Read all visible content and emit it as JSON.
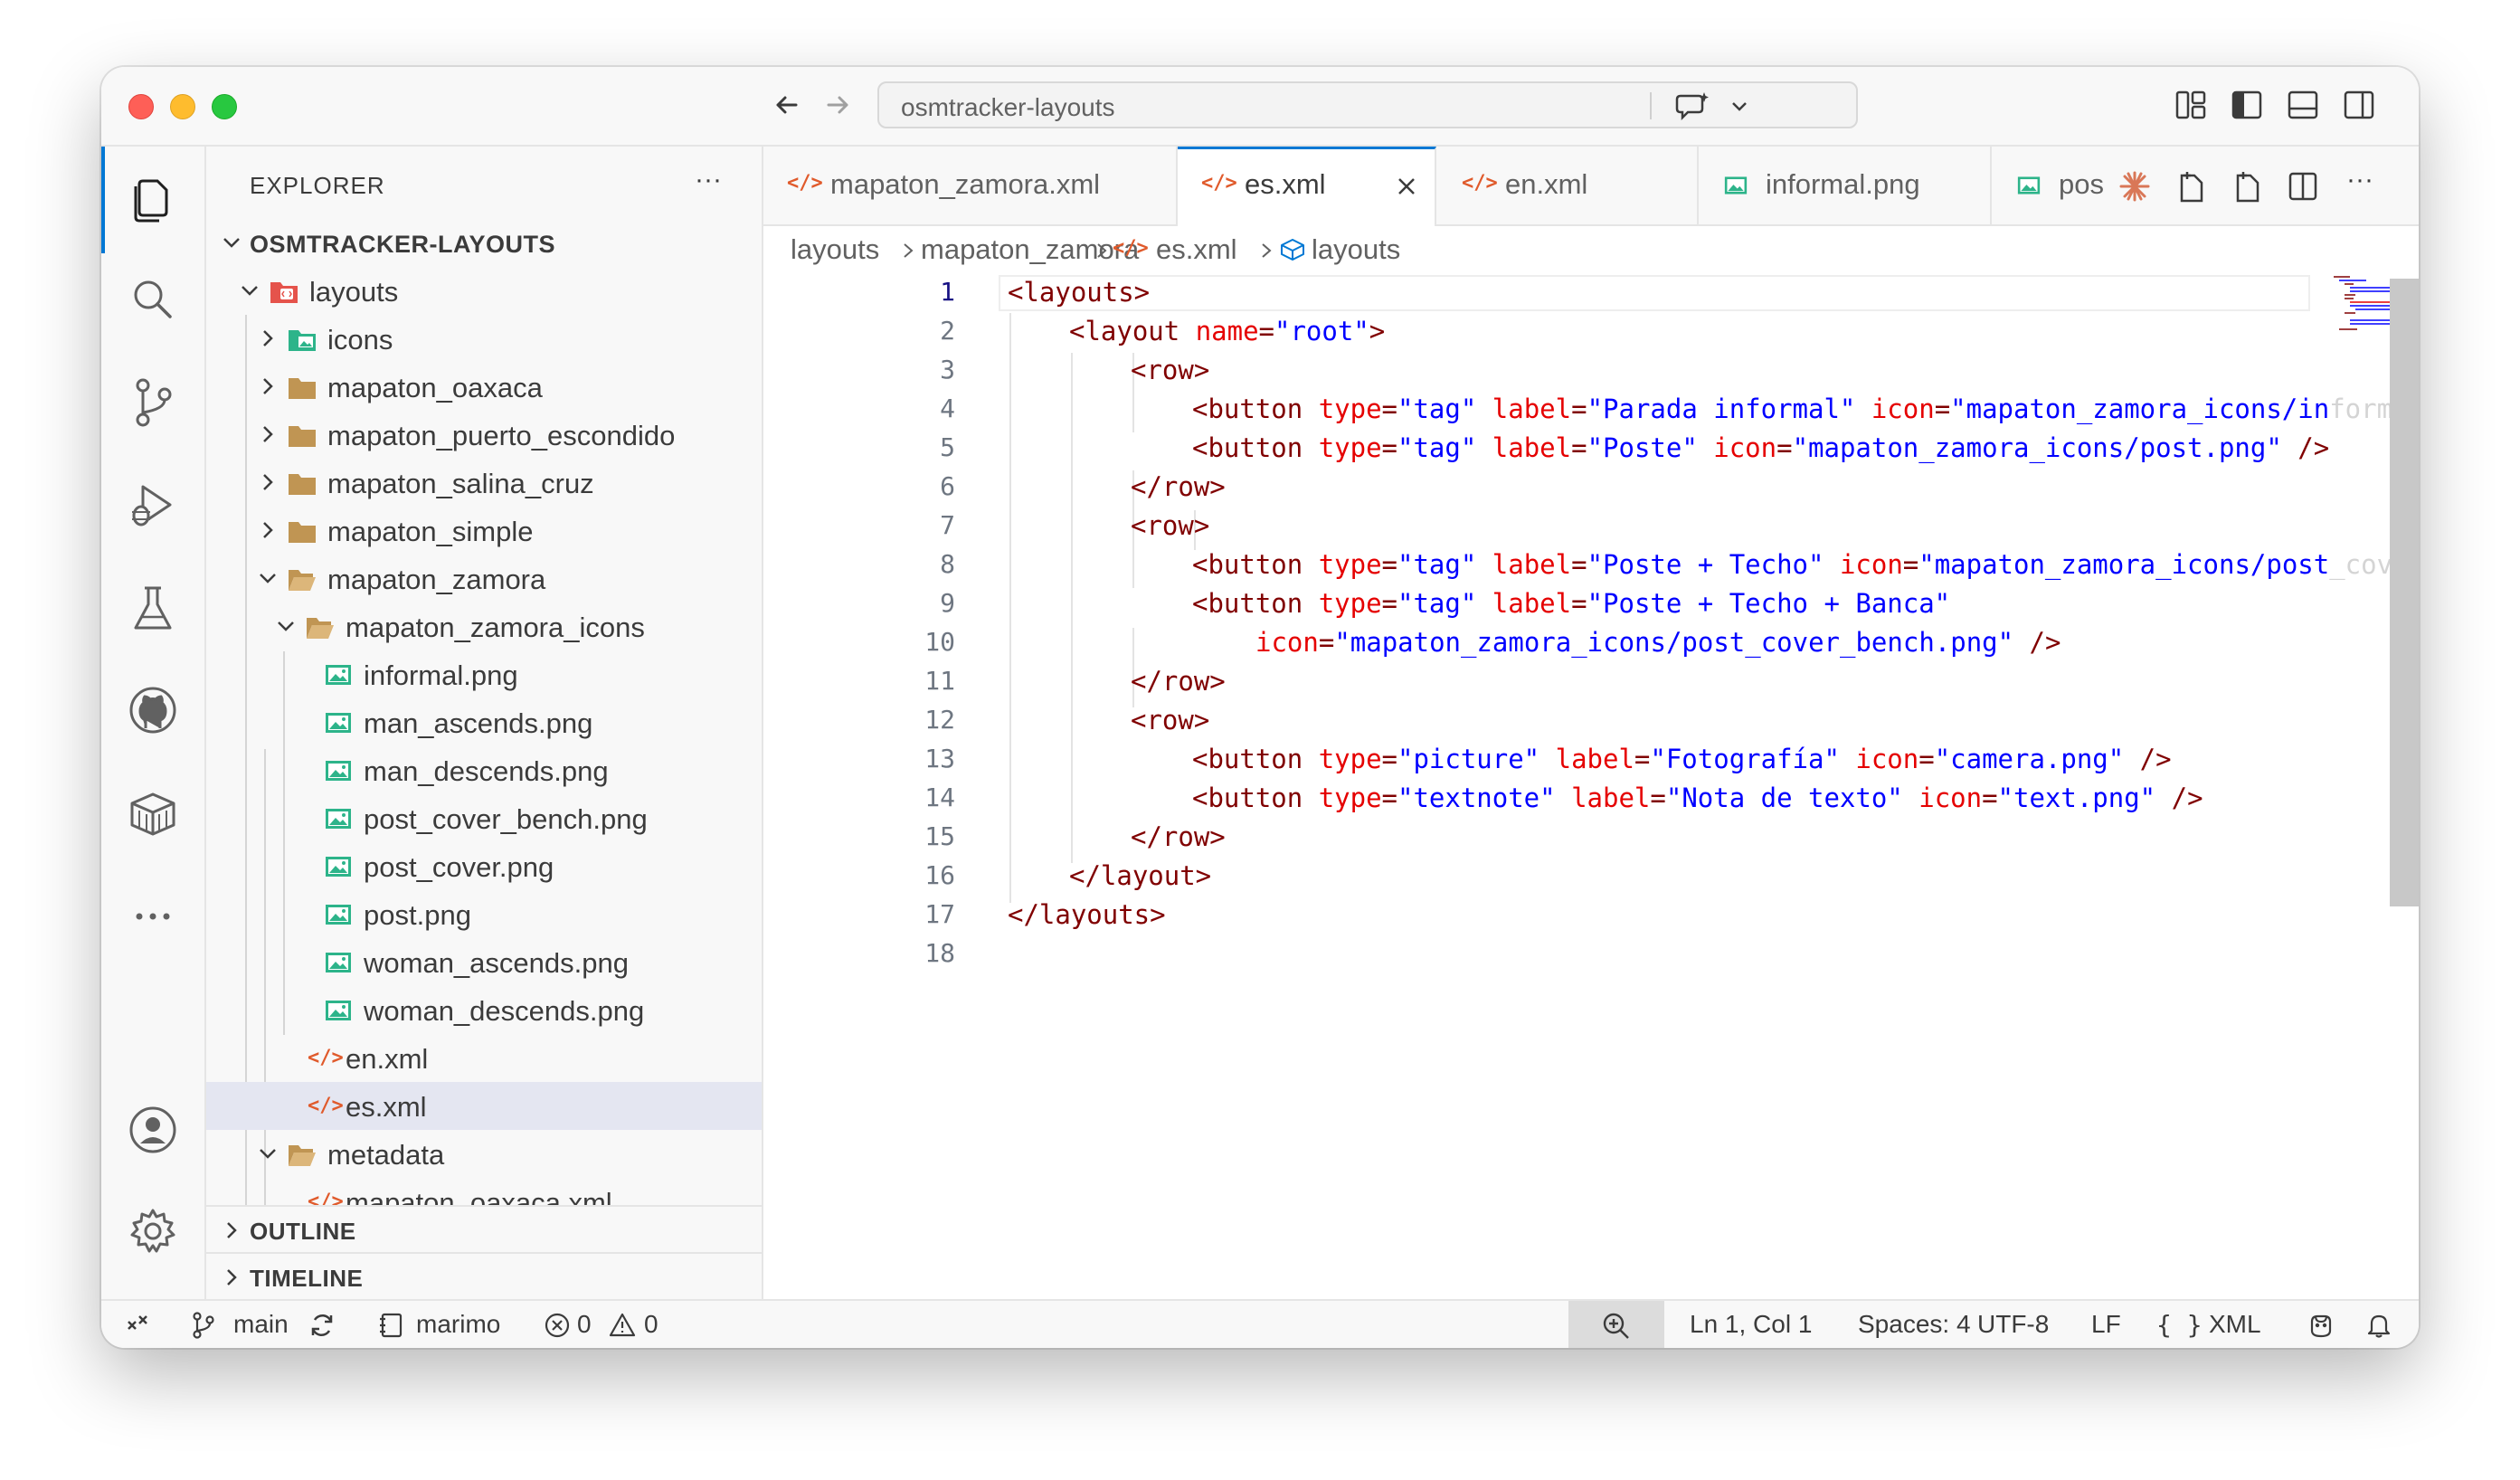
{
  "titlebar": {
    "search_text": "osmtracker-layouts"
  },
  "sidebar": {
    "header": "EXPLORER",
    "root": "OSMTRACKER-LAYOUTS",
    "tree": [
      {
        "label": "layouts"
      },
      {
        "label": "icons"
      },
      {
        "label": "mapaton_oaxaca"
      },
      {
        "label": "mapaton_puerto_escondido"
      },
      {
        "label": "mapaton_salina_cruz"
      },
      {
        "label": "mapaton_simple"
      },
      {
        "label": "mapaton_zamora"
      },
      {
        "label": "mapaton_zamora_icons"
      },
      {
        "label": "informal.png"
      },
      {
        "label": "man_ascends.png"
      },
      {
        "label": "man_descends.png"
      },
      {
        "label": "post_cover_bench.png"
      },
      {
        "label": "post_cover.png"
      },
      {
        "label": "post.png"
      },
      {
        "label": "woman_ascends.png"
      },
      {
        "label": "woman_descends.png"
      },
      {
        "label": "en.xml"
      },
      {
        "label": "es.xml"
      },
      {
        "label": "metadata"
      },
      {
        "label": "mapaton_oaxaca.xml"
      }
    ],
    "outline": "OUTLINE",
    "timeline": "TIMELINE"
  },
  "tabs": [
    {
      "label": "mapaton_zamora.xml"
    },
    {
      "label": "es.xml"
    },
    {
      "label": "en.xml"
    },
    {
      "label": "informal.png"
    },
    {
      "label": "pos"
    }
  ],
  "breadcrumb": [
    "layouts",
    "mapaton_zamora",
    "es.xml",
    "layouts"
  ],
  "editor": {
    "line_numbers": [
      "1",
      "2",
      "3",
      "4",
      "5",
      "6",
      "7",
      "8",
      "9",
      "10",
      "11",
      "12",
      "13",
      "14",
      "15",
      "16",
      "17",
      "18"
    ],
    "l1_tag": "<layouts>",
    "l2_open": "<layout ",
    "l2_attr": "name",
    "l2_val": "\"root\"",
    "l2_close": ">",
    "l3": "<row>",
    "l4_btn": "<button ",
    "l4_type": "type",
    "l4_typev": "\"tag\"",
    "l4_label": "label",
    "l4_labelv": "\"Parada informal\"",
    "l4_icon": "icon",
    "l4_iconv": "\"mapaton_zamora_icons/in",
    "l4_fade": "formal.png\"",
    "l5_btn": "<button ",
    "l5_type": "type",
    "l5_typev": "\"tag\"",
    "l5_label": "label",
    "l5_labelv": "\"Poste\"",
    "l5_icon": "icon",
    "l5_iconv": "\"mapaton_zamora_icons/post.png\"",
    "l5_end": " />",
    "l6": "</row>",
    "l7": "<row>",
    "l8_btn": "<button ",
    "l8_type": "type",
    "l8_typev": "\"tag\"",
    "l8_label": "label",
    "l8_labelv": "\"Poste + Techo\"",
    "l8_icon": "icon",
    "l8_iconv": "\"mapaton_zamora_icons/post",
    "l8_fade": "_cover.png\"",
    "l9_btn": "<button ",
    "l9_type": "type",
    "l9_typev": "\"tag\"",
    "l9_label": "label",
    "l9_labelv": "\"Poste + Techo + Banca\"",
    "l10_icon": "icon",
    "l10_iconv": "\"mapaton_zamora_icons/post_cover_bench.png\"",
    "l10_end": " />",
    "l11": "</row>",
    "l12": "<row>",
    "l13_btn": "<button ",
    "l13_type": "type",
    "l13_typev": "\"picture\"",
    "l13_label": "label",
    "l13_labelv": "\"Fotografía\"",
    "l13_icon": "icon",
    "l13_iconv": "\"camera.png\"",
    "l13_end": " />",
    "l14_btn": "<button ",
    "l14_type": "type",
    "l14_typev": "\"textnote\"",
    "l14_label": "label",
    "l14_labelv": "\"Nota de texto\"",
    "l14_icon": "icon",
    "l14_iconv": "\"text.png\"",
    "l14_end": " />",
    "l15": "</row>",
    "l16": "</layout>",
    "l17": "</layouts>"
  },
  "statusbar": {
    "branch": "main",
    "kernel": "marimo",
    "errors": "0",
    "warnings": "0",
    "position": "Ln 1, Col 1",
    "spaces": "Spaces: 4",
    "encoding": "UTF-8",
    "eol": "LF",
    "language": "XML"
  },
  "colors": {
    "accent": "#0078d4",
    "xml_tag": "#800000",
    "xml_attr": "#e50000",
    "xml_value": "#0000ff",
    "xml_file_icon": "#e05a2b",
    "image_file_icon": "#2db48a",
    "folder_icon": "#c09553"
  }
}
